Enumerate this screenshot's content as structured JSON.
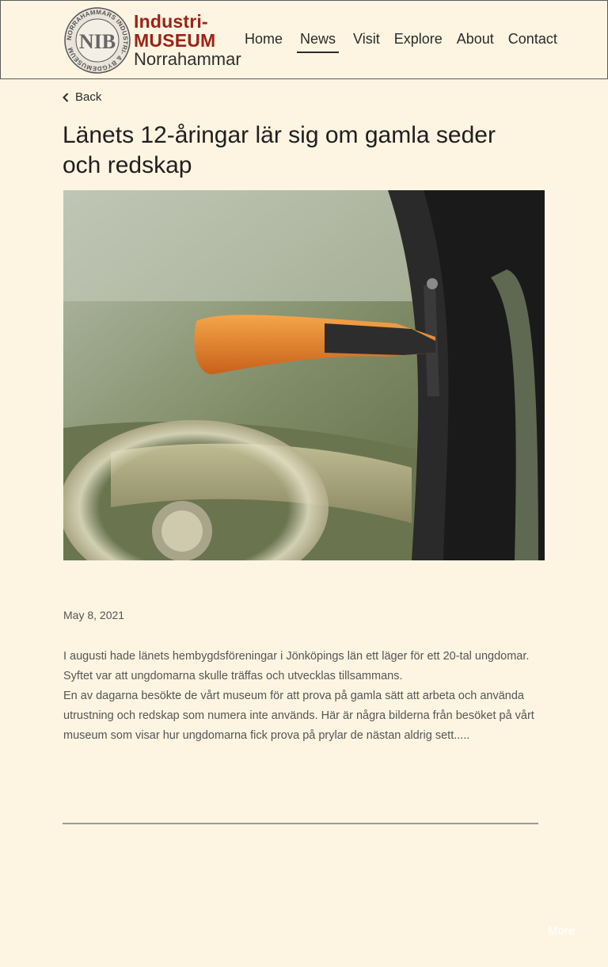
{
  "header": {
    "logo": {
      "line1": "Industri-",
      "line2": "MUSEUM",
      "line3": "Norrahammar",
      "seal_text": "NORRAHAMMARS INDUSTRI- & BYGDEMUSEUM",
      "seal_monogram": "NIB"
    },
    "nav": [
      {
        "label": "Home",
        "active": false
      },
      {
        "label": "News",
        "active": true
      },
      {
        "label": "Visit",
        "active": false
      },
      {
        "label": "Explore",
        "active": false
      },
      {
        "label": "About",
        "active": false
      },
      {
        "label": "Contact",
        "active": false
      }
    ]
  },
  "article": {
    "back_label": "Back",
    "title": "Länets 12-åringar lär sig om gamla seder och redskap",
    "date": "May 8, 2021",
    "paragraphs": [
      "I augusti hade länets hembygdsföreningar i Jönköpings län ett läger för ett 20-tal ungdomar. Syftet var att ungdomarna skulle träffas och utvecklas tillsammans.",
      "En av dagarna besökte de vårt museum för att prova på gamla sätt att arbeta och använda utrustning och redskap som numera inte används. Här är några bilderna från besöket på vårt museum som visar hur ungdomarna fick prova på prylar de nästan aldrig sett....."
    ]
  },
  "footer": {
    "more_label": "More"
  },
  "colors": {
    "background": "#fdf5e2",
    "logo_red": "#9b2316",
    "text": "#2b2b2b"
  }
}
